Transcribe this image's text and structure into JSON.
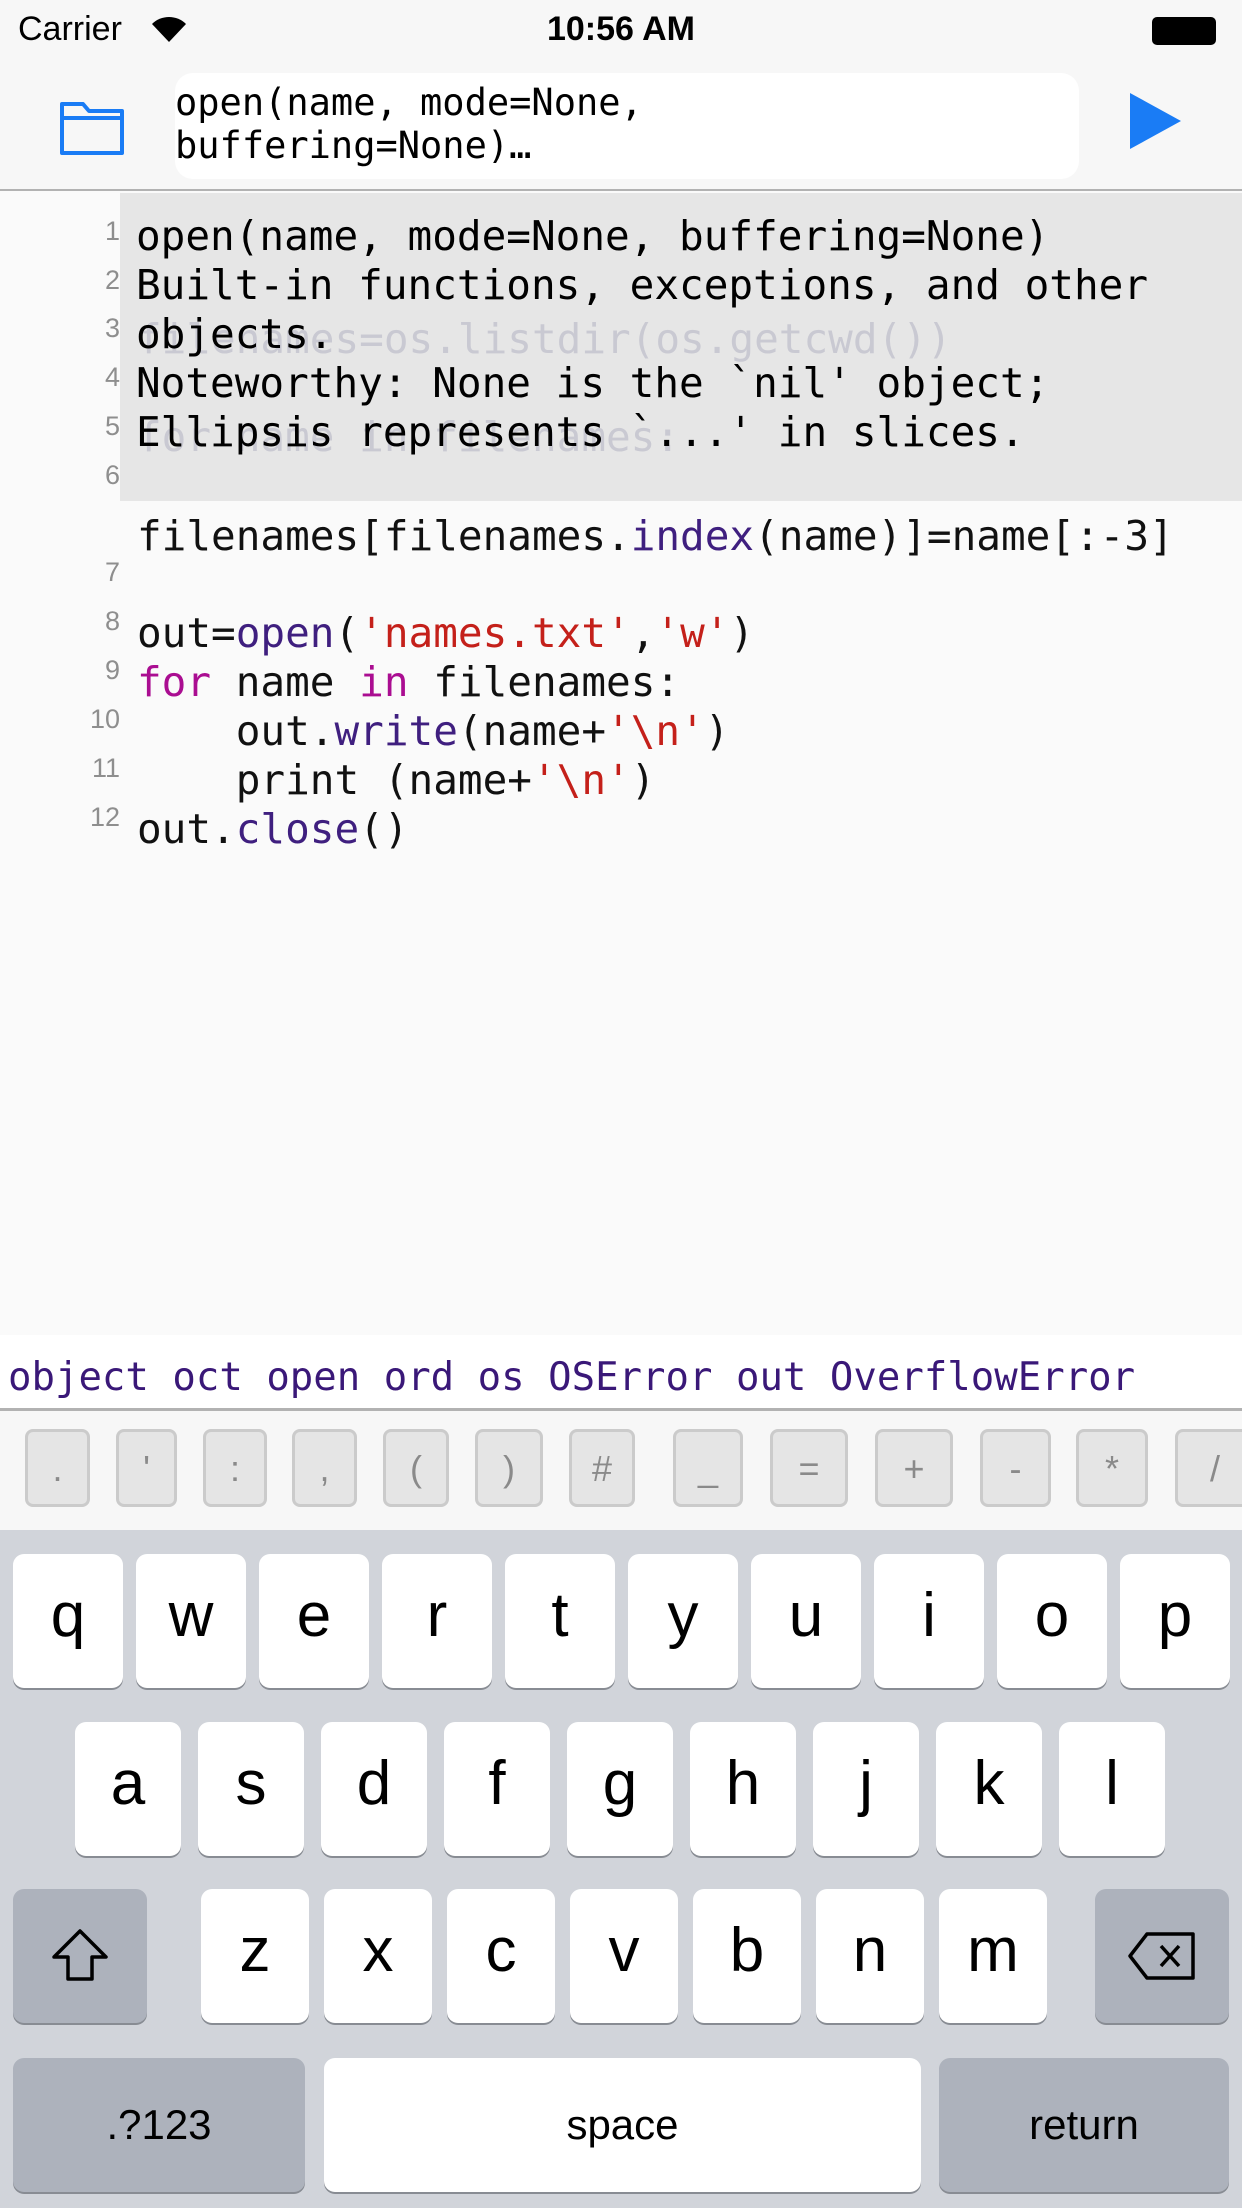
{
  "status": {
    "carrier": "Carrier",
    "time": "10:56 AM"
  },
  "toolbar": {
    "snippet_line1": "open(name, mode=None,",
    "snippet_line2": "buffering=None)…",
    "folder_icon": "folder-icon",
    "run_icon": "play-icon"
  },
  "editor": {
    "line_numbers": [
      "1",
      "2",
      "3",
      "4",
      "5",
      "6",
      "7",
      "8",
      "9",
      "10",
      "11",
      "12"
    ],
    "hidden_lines": {
      "l3": "filenames=os.listdir(os.getcwd())",
      "l5": "for name in filenames:"
    },
    "lines": [
      {
        "n": 6,
        "tokens": [
          [
            "filenames[filenames.",
            ""
          ],
          [
            "index",
            "fn"
          ],
          [
            "(name)]=name[:-3]",
            ""
          ]
        ],
        "wrapped": true
      },
      {
        "n": 8,
        "tokens": [
          [
            "out=",
            ""
          ],
          [
            "open",
            "fn"
          ],
          [
            "(",
            ""
          ],
          [
            "'names.txt'",
            "st"
          ],
          [
            ",",
            ""
          ],
          [
            "'w'",
            "st"
          ],
          [
            ")",
            ""
          ]
        ]
      },
      {
        "n": 9,
        "tokens": [
          [
            "for",
            "kw"
          ],
          [
            " name ",
            ""
          ],
          [
            "in",
            "kw"
          ],
          [
            " filenames:",
            ""
          ]
        ]
      },
      {
        "n": 10,
        "tokens": [
          [
            "    out.",
            ""
          ],
          [
            "write",
            "fn"
          ],
          [
            "(name+",
            ""
          ],
          [
            "'\\n'",
            "st"
          ],
          [
            ")",
            ""
          ]
        ]
      },
      {
        "n": 11,
        "tokens": [
          [
            "    print (name+",
            ""
          ],
          [
            "'\\n'",
            "st"
          ],
          [
            ")",
            ""
          ]
        ]
      },
      {
        "n": 12,
        "tokens": [
          [
            "out.",
            ""
          ],
          [
            "close",
            "fn"
          ],
          [
            "()",
            ""
          ]
        ]
      }
    ]
  },
  "doc_popup": [
    "open(name, mode=None, buffering=None)",
    "Built-in functions, exceptions, and other",
    "objects.",
    "Noteworthy: None is the `nil' object;",
    "Ellipsis represents `...' in slices."
  ],
  "autocomplete": [
    "object",
    "oct",
    "open",
    "ord",
    "os",
    "OSError",
    "out",
    "OverflowError"
  ],
  "symbols": [
    ".",
    "'",
    ":",
    ",",
    "(",
    ")",
    "#",
    "_",
    "=",
    "+",
    "-",
    "*",
    "/"
  ],
  "keyboard": {
    "row1": [
      "q",
      "w",
      "e",
      "r",
      "t",
      "y",
      "u",
      "i",
      "o",
      "p"
    ],
    "row2": [
      "a",
      "s",
      "d",
      "f",
      "g",
      "h",
      "j",
      "k",
      "l"
    ],
    "row3": [
      "z",
      "x",
      "c",
      "v",
      "b",
      "n",
      "m"
    ],
    "numbers": ".?123",
    "space": "space",
    "return": "return"
  }
}
